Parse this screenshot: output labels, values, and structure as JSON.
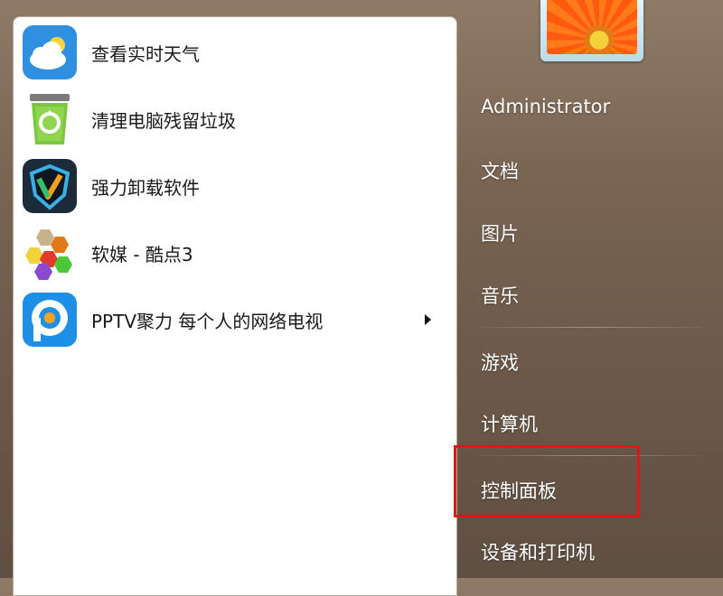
{
  "programs": [
    {
      "label": "查看实时天气",
      "icon": "weather-cloud-icon"
    },
    {
      "label": "清理电脑残留垃圾",
      "icon": "recycle-bin-icon"
    },
    {
      "label": "强力卸载软件",
      "icon": "uninstall-shield-icon"
    },
    {
      "label": "软媒 - 酷点3",
      "icon": "hexagon-cluster-icon"
    },
    {
      "label": "PPTV聚力 每个人的网络电视",
      "icon": "pptv-icon",
      "has_submenu": true
    }
  ],
  "user": {
    "name": "Administrator"
  },
  "right_menu": {
    "documents": "文档",
    "pictures": "图片",
    "music": "音乐",
    "games": "游戏",
    "computer": "计算机",
    "control_panel": "控制面板",
    "devices_printers": "设备和打印机"
  },
  "colors": {
    "highlight": "#e01515",
    "panel_bg": "#ffffff",
    "right_bg": "#7a6553"
  }
}
